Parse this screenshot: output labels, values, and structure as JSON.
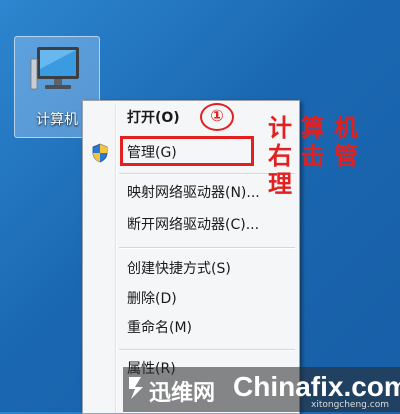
{
  "desktop": {
    "computer_icon_label": "计算机"
  },
  "context_menu": {
    "items": [
      {
        "label": "打开(O)",
        "bold": true
      },
      {
        "label": "管理(G)",
        "bold": false,
        "icon": "uac-shield-icon"
      },
      {
        "label": "映射网络驱动器(N)...",
        "bold": false
      },
      {
        "label": "断开网络驱动器(C)...",
        "bold": false
      },
      {
        "label": "创建快捷方式(S)",
        "bold": false
      },
      {
        "label": "删除(D)",
        "bold": false
      },
      {
        "label": "重命名(M)",
        "bold": false
      },
      {
        "label": "属性(R)",
        "bold": false
      }
    ]
  },
  "annotation": {
    "step_number": "①",
    "note_lines": [
      "计算机",
      "右击管",
      "理"
    ],
    "color": "#e32020"
  },
  "watermark": {
    "brand_left": "迅维网",
    "brand_right": "Chinafix.com",
    "domain": "xitongcheng.com"
  }
}
